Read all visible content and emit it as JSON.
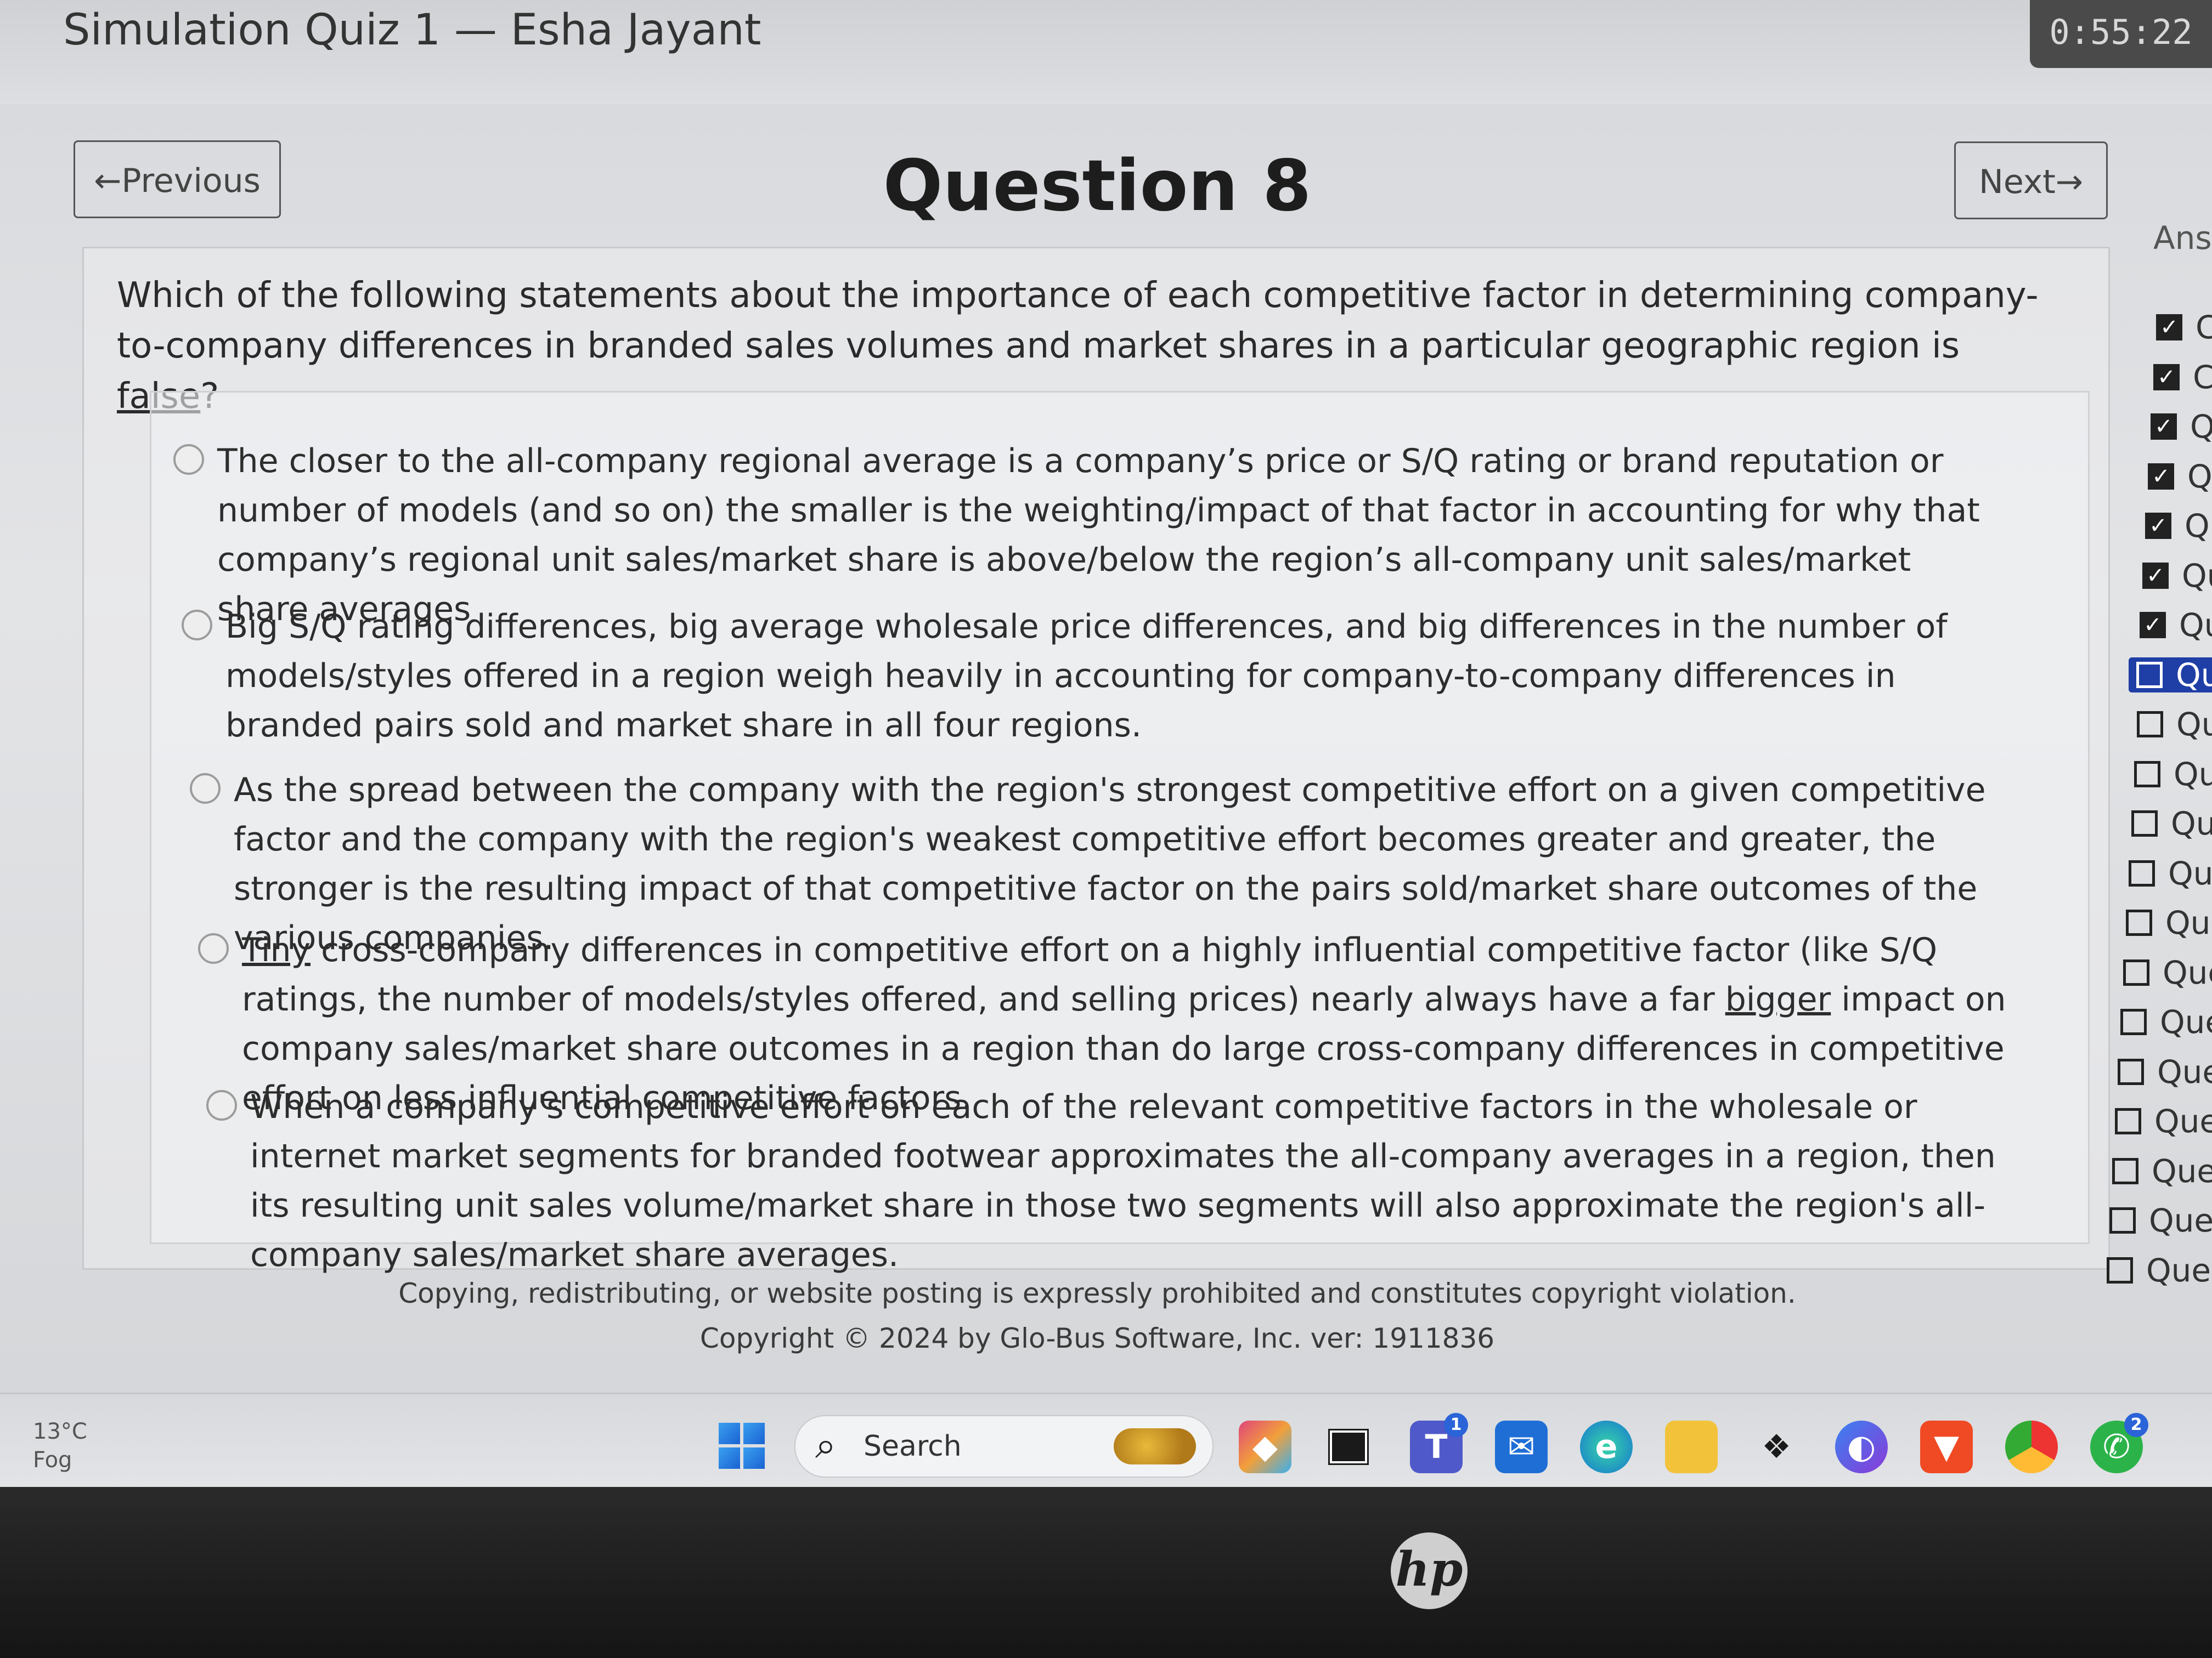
{
  "quiz": {
    "title": "Simulation Quiz 1 — Esha Jayant",
    "timer": "0:55:22"
  },
  "nav": {
    "previous_label": "←Previous",
    "next_label": "Next→"
  },
  "question": {
    "heading": "Question 8",
    "text_before": "Which of the following statements about the importance of each competitive factor in determining company-to-company differences in branded sales volumes and market shares in a particular geographic region is ",
    "text_emphasis": "false",
    "text_after": "?",
    "selected_option": null,
    "options": [
      {
        "text": "The closer to the all-company regional average is a company’s price or S/Q rating or brand reputation or number of models (and so on) the smaller is the weighting/impact of that factor in accounting for why that company’s regional unit sales/market share is above/below the region’s all-company unit sales/market share averages"
      },
      {
        "text": "Big S/Q rating differences, big average wholesale price differences, and big differences in the number of models/styles offered in a region weigh heavily in accounting for company-to-company differences in branded pairs sold and market share in all four regions."
      },
      {
        "text": "As the spread between the company with the region's strongest competitive effort on a given competitive factor and the company with the region's weakest competitive effort becomes greater and greater, the stronger is the resulting impact of that competitive factor on the pairs sold/market share outcomes of the various companies."
      },
      {
        "part1": "Tiny",
        "part2": " cross-company differences in competitive effort on a highly influential competitive factor (like S/Q ratings, the number of models/styles offered, and selling prices) nearly always have a far ",
        "part3": "bigger",
        "part4": " impact on company sales/market share outcomes in a region than do large cross-company differences in competitive effort on less influential competitive factors."
      },
      {
        "text": "When a company's competitive effort on each of the relevant competitive factors in the wholesale or internet market segments for branded footwear approximates the all-company averages in a region, then its resulting unit sales volume/market share in those two segments will also approximate the region's all-company sales/market share averages."
      }
    ]
  },
  "footer": {
    "notice": "Copying, redistributing, or website posting is expressly prohibited and constitutes copyright violation.",
    "copyright": "Copyright © 2024 by Glo-Bus Software, Inc. ver: 1911836"
  },
  "sidebar": {
    "label": "Ans",
    "items": [
      {
        "label": "C",
        "checked": true
      },
      {
        "label": "C",
        "checked": true
      },
      {
        "label": "Q",
        "checked": true
      },
      {
        "label": "Q",
        "checked": true
      },
      {
        "label": "Q",
        "checked": true
      },
      {
        "label": "Qu",
        "checked": true
      },
      {
        "label": "Qu",
        "checked": true
      },
      {
        "label": "Qu",
        "checked": false,
        "current": true
      },
      {
        "label": "Qu",
        "checked": false
      },
      {
        "label": "Qu",
        "checked": false
      },
      {
        "label": "Que",
        "checked": false
      },
      {
        "label": "Que",
        "checked": false
      },
      {
        "label": "Que",
        "checked": false
      },
      {
        "label": "Que",
        "checked": false
      },
      {
        "label": "Que",
        "checked": false
      },
      {
        "label": "Ques",
        "checked": false
      },
      {
        "label": "Ques",
        "checked": false
      },
      {
        "label": "Ques",
        "checked": false
      },
      {
        "label": "Ques",
        "checked": false
      },
      {
        "label": "Quest",
        "checked": false
      }
    ]
  },
  "taskbar": {
    "weather_temp": "13°C",
    "weather_desc": "Fog",
    "search_label": "Search",
    "teams_badge": "1",
    "whatsapp_badge": "2"
  },
  "colors": {
    "accent_current": "#1f3fa6",
    "windows_blue": "#1a62d2"
  }
}
